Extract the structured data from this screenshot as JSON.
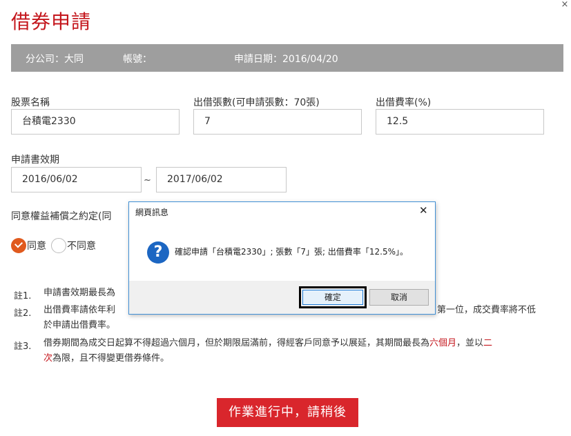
{
  "page": {
    "title": "借券申請",
    "close_glyph": "×"
  },
  "info_bar": {
    "branch": "分公司：大同",
    "account": "帳號：",
    "apply_date": "申請日期：2016/04/20"
  },
  "form": {
    "stock_name_label": "股票名稱",
    "stock_name_value": "台積電2330",
    "lend_qty_label": "出借張數(可申請張數：70張)",
    "lend_qty_value": "7",
    "lend_rate_label": "出借費率(%)",
    "lend_rate_value": "12.5",
    "validity_label": "申請書效期",
    "validity_start": "2016/06/02",
    "validity_sep": "~",
    "validity_end": "2017/06/02",
    "rights_label": "同意權益補償之約定(同",
    "agree_label": "同意",
    "disagree_label": "不同意",
    "agree_selected": true
  },
  "notes": [
    {
      "tag": "註1.",
      "text": "申請書效期最長為"
    },
    {
      "tag": "註2.",
      "text_line1_left": "出借費率請依年利",
      "text_line1_right": "第一位，成交費率將不低",
      "text_line2": "於申請出借費率。"
    },
    {
      "tag": "註3.",
      "text_a": "借券期間為成交日起算不得超過六個月，但於期限屆滿前，得經客戶同意予以展延，其期間最長為",
      "text_red1": "六個月",
      "text_b": "，並以",
      "text_red2a": "二",
      "text_red2b": "次",
      "text_c": "為限，且不得變更借券條件。"
    }
  ],
  "submit_button": "作業進行中，請稍後",
  "dialog": {
    "title": "網頁訊息",
    "close_glyph": "✕",
    "icon_glyph": "?",
    "message": "確認申請「台積電2330」; 張數「7」張; 出借費率「12.5%」。",
    "ok_label": "確定",
    "cancel_label": "取消"
  },
  "colors": {
    "brand_red": "#c4161c",
    "info_bar_gray": "#9e9e9e",
    "radio_orange": "#e05a1e",
    "dialog_border": "#3f8fd5",
    "question_icon_blue": "#1c66c2"
  }
}
